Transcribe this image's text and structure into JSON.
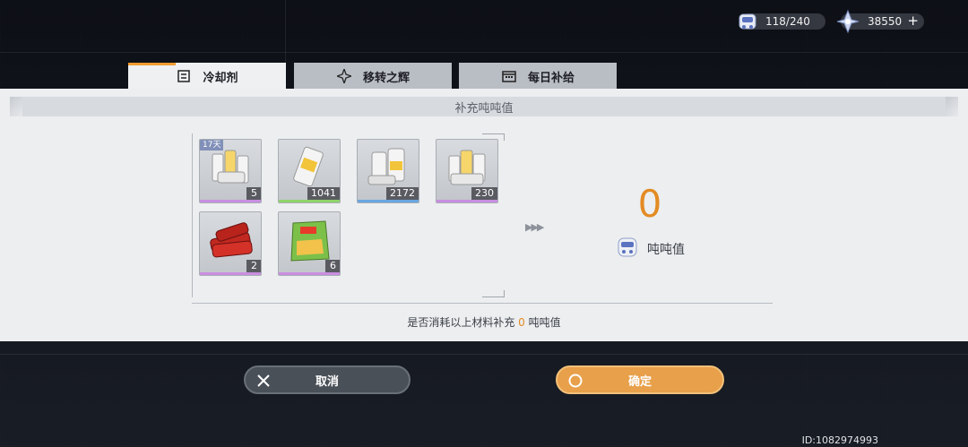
{
  "currency": {
    "energy": "118/240",
    "crystals": "38550",
    "plus": "+"
  },
  "tabs": [
    {
      "label": "冷却剂",
      "active": true
    },
    {
      "label": "移转之辉",
      "active": false
    },
    {
      "label": "每日补给",
      "active": false
    }
  ],
  "panel": {
    "title": "补充吨吨值"
  },
  "items": [
    {
      "count": "5",
      "timer": "17天",
      "rarity": "#c98ee0"
    },
    {
      "count": "1041",
      "rarity": "#8fd46a"
    },
    {
      "count": "2172",
      "rarity": "#6aa6e0"
    },
    {
      "count": "230",
      "rarity": "#c98ee0"
    },
    {
      "count": "2",
      "rarity": "#c98ee0"
    },
    {
      "count": "6",
      "rarity": "#c98ee0"
    }
  ],
  "result": {
    "value": "0",
    "label": "吨吨值"
  },
  "confirm": {
    "prefix": "是否消耗以上材料补充 ",
    "amount": "0",
    "suffix": " 吨吨值"
  },
  "buttons": {
    "cancel": "取消",
    "ok": "确定"
  },
  "uid": "ID:1082974993",
  "colors": {
    "accent": "#e38b24",
    "panel": "#eceef0"
  }
}
